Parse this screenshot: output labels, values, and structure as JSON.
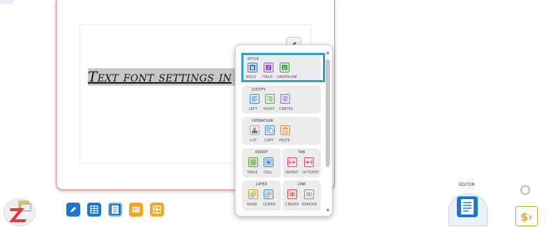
{
  "document": {
    "selected_text": "Text font settings in"
  },
  "style_group": {
    "title": "STYLE",
    "buttons": [
      {
        "label": "BOLD",
        "icon": "bold-icon",
        "color": "#3b6fd6"
      },
      {
        "label": "ITALIC",
        "icon": "italic-icon",
        "color": "#8f4fd0"
      },
      {
        "label": "UNDERLINE",
        "icon": "underline-icon",
        "color": "#3d9a45"
      }
    ]
  },
  "justify_group": {
    "title": "JUSTIFY",
    "buttons": [
      {
        "label": "LEFT",
        "icon": "align-left-icon",
        "color": "#3b88d6"
      },
      {
        "label": "RIGHT",
        "icon": "align-right-icon",
        "color": "#5fa94a"
      },
      {
        "label": "CENTER",
        "icon": "align-center-icon",
        "color": "#8f6fd0"
      }
    ]
  },
  "operation_group": {
    "title": "OPERATION",
    "buttons": [
      {
        "label": "CUT",
        "icon": "scissors-icon",
        "color": "#555555"
      },
      {
        "label": "COPY",
        "icon": "copy-icon",
        "color": "#3b88d6"
      },
      {
        "label": "PASTE",
        "icon": "paste-icon",
        "color": "#e0892e"
      }
    ]
  },
  "insert_group": {
    "title": "INSERT",
    "buttons": [
      {
        "label": "TABLE",
        "icon": "table-icon",
        "color": "#5a9a3a"
      },
      {
        "label": "CELL",
        "icon": "cell-icon",
        "color": "#3b88d6"
      }
    ]
  },
  "tab_group": {
    "title": "TAB",
    "buttons": [
      {
        "label": "INDENT",
        "icon": "indent-icon",
        "color": "#e0457a"
      },
      {
        "label": "OUTDENT",
        "icon": "outdent-icon",
        "color": "#e0457a"
      }
    ]
  },
  "layer_group": {
    "title": "LAYER",
    "buttons": [
      {
        "label": "RAISE",
        "icon": "raise-icon",
        "color": "#c7a12a"
      },
      {
        "label": "LOWER",
        "icon": "lower-icon",
        "color": "#3b88d6"
      }
    ]
  },
  "link_group": {
    "title": "LINK",
    "buttons": [
      {
        "label": "CREATE",
        "icon": "link-create-icon",
        "color": "#d04545"
      },
      {
        "label": "REMOVE",
        "icon": "link-remove-icon",
        "color": "#888888"
      }
    ]
  },
  "bottom_right": {
    "editor_label": "EDITOR",
    "dollar_symbol": "$›"
  },
  "colors": {
    "highlight": "#2c9fd9",
    "card_border": "#e48a83",
    "app_blue": "#1d76d0",
    "app_orange": "#f5a623"
  }
}
